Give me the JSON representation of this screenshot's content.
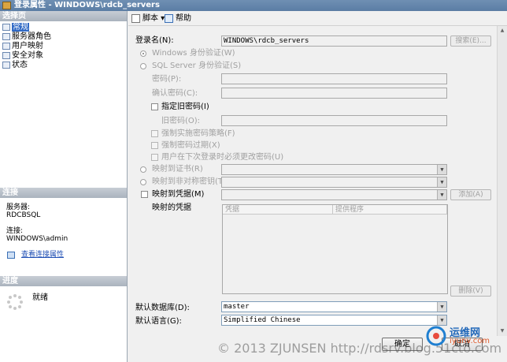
{
  "window": {
    "title": "登录属性 - WINDOWS\\rdcb_servers"
  },
  "left_panel": {
    "select_page_header": "选择页",
    "pages": [
      {
        "label": "常规",
        "selected": true
      },
      {
        "label": "服务器角色",
        "selected": false
      },
      {
        "label": "用户映射",
        "selected": false
      },
      {
        "label": "安全对象",
        "selected": false
      },
      {
        "label": "状态",
        "selected": false
      }
    ],
    "connection_header": "连接",
    "server_label": "服务器:",
    "server_value": "RDCBSQL",
    "connection_label": "连接:",
    "connection_value": "WINDOWS\\admin",
    "view_connection_link": "查看连接属性",
    "progress_header": "进度",
    "progress_status": "就绪"
  },
  "toolbar": {
    "script_label": "脚本",
    "help_label": "帮助"
  },
  "form": {
    "login_name_label": "登录名(N):",
    "login_name_value": "WINDOWS\\rdcb_servers",
    "search_button": "搜索(E)...",
    "windows_auth": "Windows 身份验证(W)",
    "sql_auth": "SQL Server 身份验证(S)",
    "password_label": "密码(P):",
    "confirm_password_label": "确认密码(C):",
    "old_password_check": "指定旧密码(I)",
    "old_password_label": "旧密码(O):",
    "enforce_policy": "强制实施密码策略(F)",
    "enforce_expiration": "强制密码过期(X)",
    "must_change": "用户在下次登录时必须更改密码(U)",
    "map_cert": "映射到证书(R)",
    "map_asym_key": "映射到非对称密钥(T)",
    "map_credential": "映射到凭据(M)",
    "add_button": "添加(A)",
    "mapped_credentials_label": "映射的凭据",
    "grid_columns": [
      "凭据",
      "提供程序"
    ],
    "remove_button": "删除(V)",
    "default_db_label": "默认数据库(D):",
    "default_db_value": "master",
    "default_lang_label": "默认语言(G):",
    "default_lang_value": "Simplified Chinese"
  },
  "footer": {
    "ok_button": "确定",
    "cancel_button": "取消"
  },
  "watermark": {
    "text": "© 2013 ZJUNSEN http://rdsrv.blog.51cto.com",
    "logo_text": "运维网",
    "logo_sub": "iyunv.com"
  }
}
